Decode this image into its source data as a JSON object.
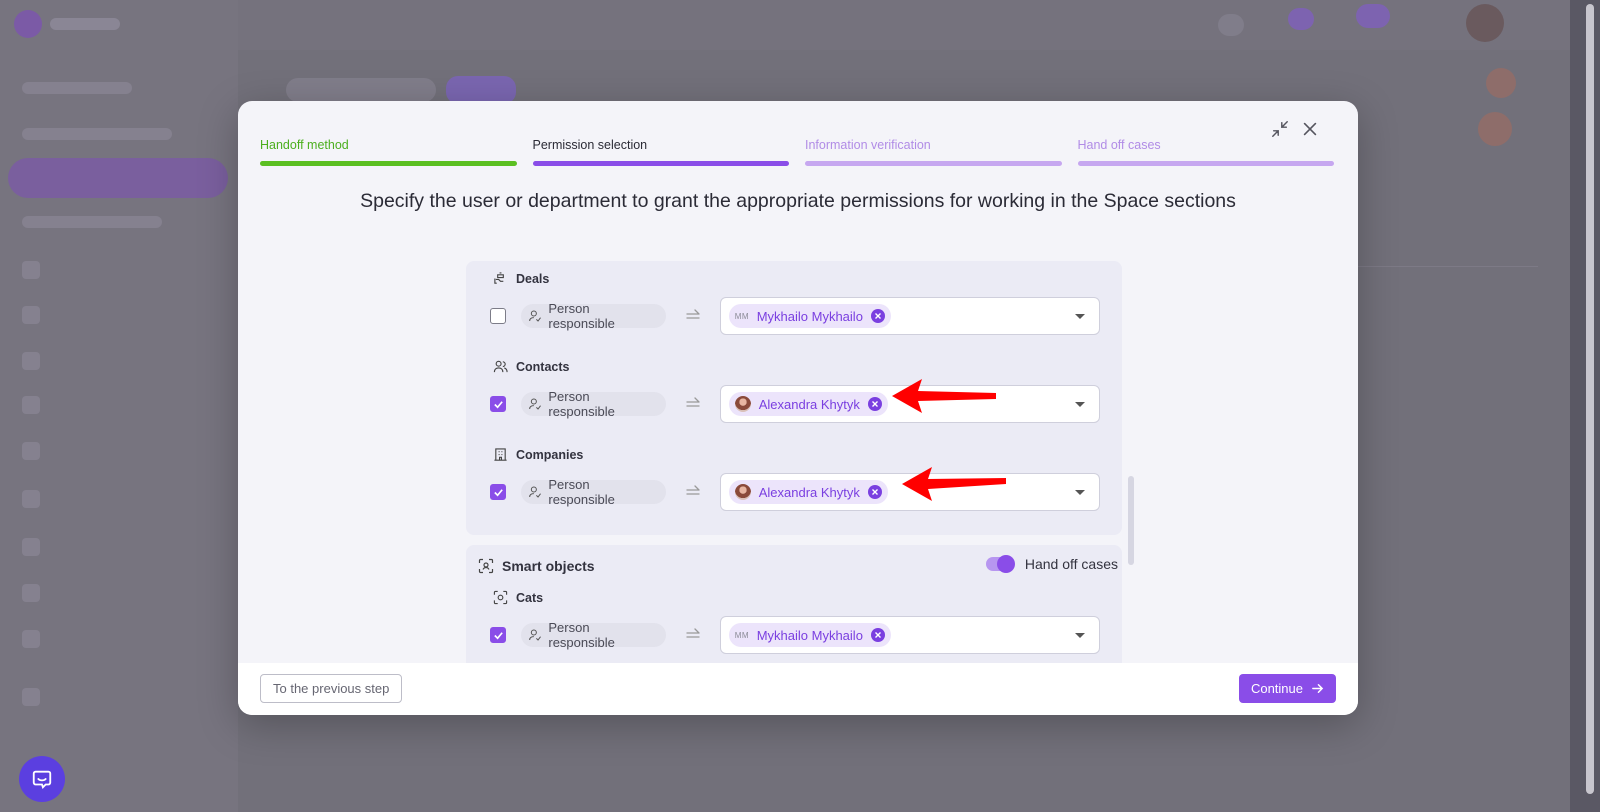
{
  "steps": [
    {
      "label": "Handoff method",
      "state": "done"
    },
    {
      "label": "Permission selection",
      "state": "current"
    },
    {
      "label": "Information verification",
      "state": "todo"
    },
    {
      "label": "Hand off cases",
      "state": "todo"
    }
  ],
  "heading": "Specify the user or department to grant the appropriate permissions for working in the Space sections",
  "sections": {
    "deals": {
      "title": "Deals",
      "checked": false,
      "role": "Person responsible",
      "assignee": {
        "name": "Mykhailo Mykhailo",
        "initials": "MM"
      }
    },
    "contacts": {
      "title": "Contacts",
      "checked": true,
      "role": "Person responsible",
      "assignee": {
        "name": "Alexandra Khytyk"
      }
    },
    "companies": {
      "title": "Companies",
      "checked": true,
      "role": "Person responsible",
      "assignee": {
        "name": "Alexandra Khytyk"
      }
    }
  },
  "smart_objects": {
    "title": "Smart objects",
    "toggle_label": "Hand off cases",
    "toggle_on": true,
    "cats": {
      "title": "Cats",
      "checked": true,
      "role": "Person responsible",
      "assignee": {
        "name": "Mykhailo Mykhailo",
        "initials": "MM"
      }
    }
  },
  "footer": {
    "prev_label": "To the previous step",
    "next_label": "Continue"
  },
  "colors": {
    "accent": "#8a4de8",
    "done": "#5bbf22",
    "annotation": "#ff0000"
  }
}
